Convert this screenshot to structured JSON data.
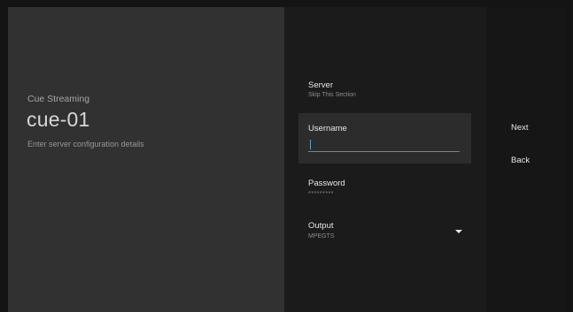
{
  "guidance": {
    "breadcrumb": "Cue Streaming",
    "title": "cue-01",
    "description": "Enter server configuration details"
  },
  "form": {
    "server": {
      "title": "Server",
      "value": "Skip This Section"
    },
    "username": {
      "title": "Username",
      "value": ""
    },
    "password": {
      "title": "Password",
      "value": "*********"
    },
    "output": {
      "title": "Output",
      "value": "MPEGTS",
      "icon": "dropdown-arrow-icon"
    }
  },
  "actions": {
    "next_label": "Next",
    "back_label": "Back"
  },
  "colors": {
    "accent": "#4e8fb5",
    "guidance_bg": "#313131",
    "form_bg": "#1b1b1b",
    "selected_bg": "#2c2c2c"
  }
}
